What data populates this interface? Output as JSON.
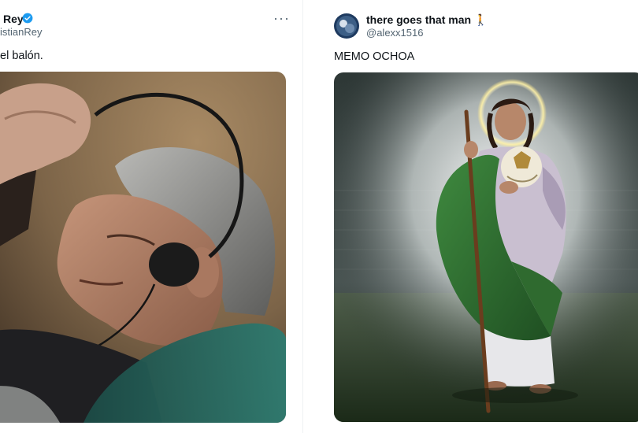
{
  "left_tweet": {
    "author_name": "Rey",
    "author_handle": "istianRey",
    "text": "el balón.",
    "more_label": "···",
    "image_alt": "Man with closed eyes wearing headphones"
  },
  "right_tweet": {
    "author_name": "there goes that man 🚶",
    "author_handle": "@alexx1516",
    "text": "MEMO OCHOA",
    "image_alt": "Saint figure with halo holding a ball and staff on a football pitch"
  },
  "colors": {
    "verified": "#1d9bf0",
    "handle": "#536471",
    "text": "#0f1419"
  }
}
